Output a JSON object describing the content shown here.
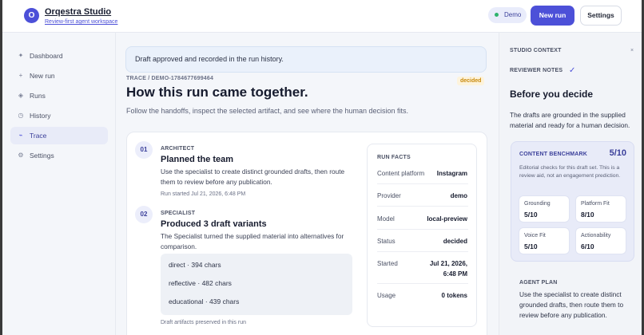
{
  "header": {
    "logo_letter": "O",
    "app_title": "Orqestra Studio",
    "app_subtitle": "Review-first agent workspace",
    "demo_label": "Demo",
    "new_run_label": "New run",
    "settings_label": "Settings"
  },
  "sidebar": {
    "items": [
      {
        "label": "Dashboard",
        "icon": "✦"
      },
      {
        "label": "New run",
        "icon": "+"
      },
      {
        "label": "Runs",
        "icon": "◈"
      },
      {
        "label": "History",
        "icon": "◷"
      },
      {
        "label": "Trace",
        "icon": "⌁"
      },
      {
        "label": "Settings",
        "icon": "⚙"
      }
    ],
    "active": "Trace"
  },
  "main": {
    "banner": "Draft approved and recorded in the run history.",
    "trace_id": "TRACE / DEMO-1784677699464",
    "status_badge": "decided",
    "title": "How this run came together.",
    "subtitle": "Follow the handoffs, inspect the selected artifact, and see where the human decision fits.",
    "steps": [
      {
        "num": "01",
        "role": "ARCHITECT",
        "title": "Planned the team",
        "desc": "Use the specialist to create distinct grounded drafts, then route them to review before any publication.",
        "meta": "Run started Jul 21, 2026, 6:48 PM"
      },
      {
        "num": "02",
        "role": "SPECIALIST",
        "title": "Produced 3 draft variants",
        "desc": "The Specialist turned the supplied material into alternatives for comparison.",
        "variants": [
          "direct · 394 chars",
          "reflective · 482 chars",
          "educational · 439 chars"
        ],
        "meta": "Draft artifacts preserved in this run"
      }
    ],
    "run_facts": {
      "title": "RUN FACTS",
      "rows": [
        {
          "label": "Content platform",
          "value": "Instagram"
        },
        {
          "label": "Provider",
          "value": "demo"
        },
        {
          "label": "Model",
          "value": "local-preview"
        },
        {
          "label": "Status",
          "value": "decided"
        },
        {
          "label": "Started",
          "value": "Jul 21, 2026, 6:48 PM"
        },
        {
          "label": "Usage",
          "value": "0 tokens"
        }
      ]
    }
  },
  "context_panel": {
    "label": "STUDIO CONTEXT",
    "close_icon": "×",
    "reviewer_notes_label": "REVIEWER NOTES",
    "check_icon": "✓",
    "heading": "Before you decide",
    "text": "The drafts are grounded in the supplied material and ready for a human decision.",
    "benchmark": {
      "title": "CONTENT BENCHMARK",
      "score": "5/10",
      "desc": "Editorial checks for this draft set. This is a review aid, not an engagement prediction.",
      "metrics": [
        {
          "label": "Grounding",
          "value": "5/10"
        },
        {
          "label": "Platform Fit",
          "value": "8/10"
        },
        {
          "label": "Voice Fit",
          "value": "5/10"
        },
        {
          "label": "Actionability",
          "value": "6/10"
        }
      ]
    },
    "agent_plan_label": "AGENT PLAN",
    "agent_plan_text": "Use the specialist to create distinct grounded drafts, then route them to review before any publication."
  },
  "colors": {
    "accent": "#4c50d8",
    "decided_badge": "#c98a0c",
    "demo_dot": "#2fb36d"
  }
}
